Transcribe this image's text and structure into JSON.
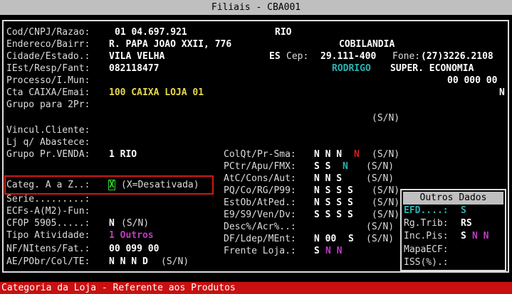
{
  "window": {
    "title": "Filiais - CBA001"
  },
  "fields": {
    "cod": {
      "label": "Cod/CNPJ/Razao:",
      "value": "01 04.697.921",
      "razao": "RIO"
    },
    "endereco": {
      "label": "Endereco/Bairr:",
      "value": "R. PAPA JOAO XXII, 776",
      "bairro": "COBILANDIA"
    },
    "cidade": {
      "label": "Cidade/Estado.:",
      "value": "VILA VELHA",
      "estado": "ES",
      "cep_label": "Cep:",
      "cep": "29.111-400",
      "fone_label": "Fone:",
      "fone": "(27)3226.2108"
    },
    "iest": {
      "label": "IEst/Resp/Fant:",
      "value": "082118477",
      "resp": "RODRIGO",
      "fant": "SUPER. ECONOMIA"
    },
    "processo": {
      "label": "Processo/I.Mun:",
      "value": "00 000 00"
    },
    "cta": {
      "label": "Cta CAIXA/Emai:",
      "value": "100 CAIXA LOJA 01",
      "flag": "N"
    },
    "grupo2pr": {
      "label": "Grupo para 2Pr:",
      "sn": "(S/N)"
    },
    "vincul": {
      "label": "Vincul.Cliente:"
    },
    "lj": {
      "label": "Lj q/ Abastece:"
    },
    "grupovenda": {
      "label": "Grupo Pr.VENDA:",
      "value": "1 RIO"
    },
    "categ": {
      "label": "Categ. A a Z..:",
      "value": "X",
      "hint": "(X=Desativada)"
    },
    "serie": {
      "label": "Serie.........:"
    },
    "ecfs": {
      "label": "ECFs-A(M2)-Fun:"
    },
    "cfop": {
      "label": "CFOP 5905.....:",
      "value": "N",
      "sn": "(S/N)"
    },
    "tipo": {
      "label": "Tipo Atividade:",
      "value": "1 Outros"
    },
    "nf": {
      "label": "NF/NItens/Fat.:",
      "value": "00 099 00"
    },
    "ae": {
      "label": "AE/PObr/Col/TE:",
      "value": "N N N D",
      "sn": "(S/N)"
    }
  },
  "right": {
    "colqt": {
      "label": "ColQt/Pr-Sma:",
      "v1": "N N N",
      "v2": "N",
      "sn": "(S/N)"
    },
    "pctr": {
      "label": "PCtr/Apu/FMX:",
      "v1": "S S",
      "v2": "N",
      "sn": "(S/N)"
    },
    "atc": {
      "label": "AtC/Cons/Aut:",
      "v1": "N N S",
      "sn": "(S/N)"
    },
    "pq": {
      "label": "PQ/Co/RG/P99:",
      "v1": "N S S S",
      "sn": "(S/N)"
    },
    "estob": {
      "label": "EstOb/AtPed.:",
      "v1": "N S S S",
      "sn": "(S/N)"
    },
    "e9": {
      "label": "E9/S9/Ven/Dv:",
      "v1": "S S S S",
      "sn": "(S/N)"
    },
    "desc": {
      "label": "Desc%/Acr%..:",
      "sn": "(S/N)"
    },
    "df": {
      "label": "DF/Ldep/MEnt:",
      "v1": "N 00",
      "v2": "S",
      "sn": "(S/N)"
    },
    "frente": {
      "label": "Frente Loja.:",
      "v1": "S",
      "v2": "N N"
    }
  },
  "popup": {
    "title": "Outros Dados",
    "efd": {
      "label": "EFD....:",
      "value": "S"
    },
    "rgtrib": {
      "label": "Rg.Trib:",
      "value": "RS"
    },
    "incpis": {
      "label": "Inc.Pis:",
      "v1": "S",
      "v2": "N N"
    },
    "mapaecf": {
      "label": "MapaECF:"
    },
    "iss": {
      "label": "ISS(%).:"
    }
  },
  "status": {
    "text": "Categoria da Loja - Referente aos Produtos"
  },
  "colors": {
    "background": "#000000",
    "status_bar": "#c81010",
    "highlight_box": "#d01818",
    "cursor": "#2fd12f"
  }
}
